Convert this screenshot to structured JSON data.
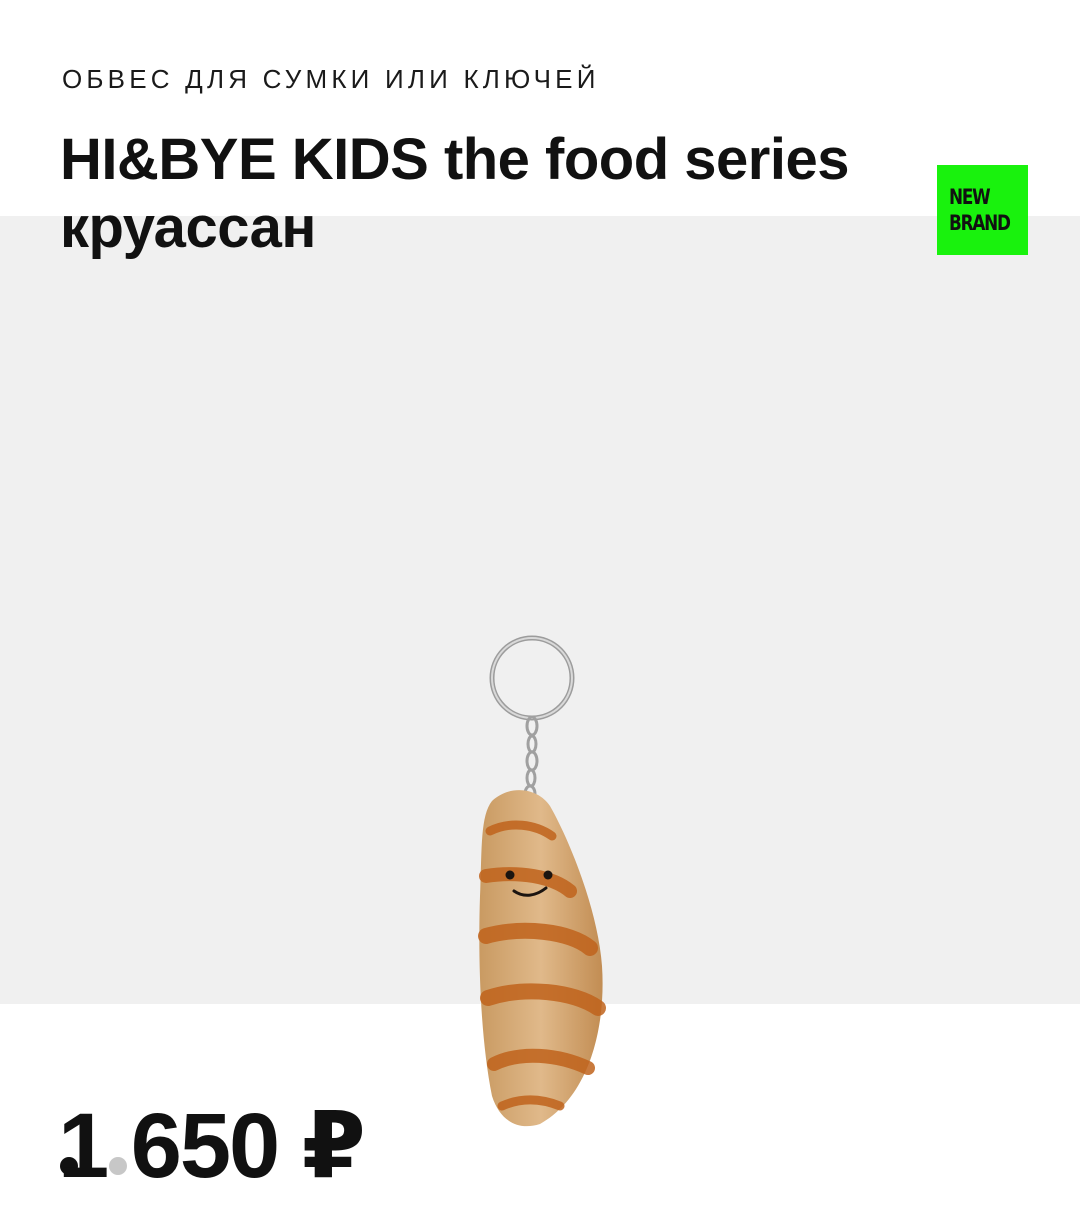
{
  "product": {
    "category": "ОБВЕС ДЛЯ СУМКИ ИЛИ КЛЮЧЕЙ",
    "title_line1": "HI&BYE KIDS the food series",
    "title_line2": "круассан",
    "badge_line1": "NEW",
    "badge_line2": "BRAND",
    "price": "1 650 ₽"
  },
  "gallery": {
    "image_name": "croissant-keychain-photo",
    "slide_count": 2,
    "active_slide": 1
  },
  "colors": {
    "badge_bg": "#19f20d",
    "gallery_bg": "#f0f0f0",
    "dot_active": "#111111",
    "dot_inactive": "#c7c7c7"
  }
}
